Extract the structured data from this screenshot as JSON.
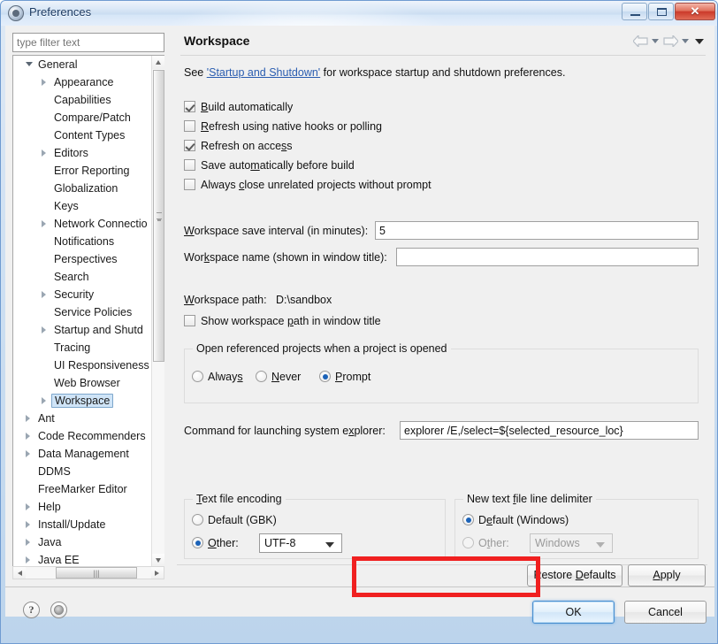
{
  "window": {
    "title": "Preferences",
    "icon": "gear-icon",
    "controls": {
      "minimize": "minimize-icon",
      "maximize": "maximize-icon",
      "close": "close-icon"
    }
  },
  "sidebar": {
    "filter": {
      "placeholder": "type filter text",
      "value": ""
    },
    "tree": [
      {
        "label": "General",
        "level": 0,
        "expander": "open",
        "selected": false
      },
      {
        "label": "Appearance",
        "level": 1,
        "expander": "collapsed",
        "selected": false
      },
      {
        "label": "Capabilities",
        "level": 1,
        "expander": "none",
        "selected": false
      },
      {
        "label": "Compare/Patch",
        "level": 1,
        "expander": "none",
        "selected": false
      },
      {
        "label": "Content Types",
        "level": 1,
        "expander": "none",
        "selected": false
      },
      {
        "label": "Editors",
        "level": 1,
        "expander": "collapsed",
        "selected": false
      },
      {
        "label": "Error Reporting",
        "level": 1,
        "expander": "none",
        "selected": false
      },
      {
        "label": "Globalization",
        "level": 1,
        "expander": "none",
        "selected": false
      },
      {
        "label": "Keys",
        "level": 1,
        "expander": "none",
        "selected": false
      },
      {
        "label": "Network Connectio",
        "level": 1,
        "expander": "collapsed",
        "selected": false
      },
      {
        "label": "Notifications",
        "level": 1,
        "expander": "none",
        "selected": false
      },
      {
        "label": "Perspectives",
        "level": 1,
        "expander": "none",
        "selected": false
      },
      {
        "label": "Search",
        "level": 1,
        "expander": "none",
        "selected": false
      },
      {
        "label": "Security",
        "level": 1,
        "expander": "collapsed",
        "selected": false
      },
      {
        "label": "Service Policies",
        "level": 1,
        "expander": "none",
        "selected": false
      },
      {
        "label": "Startup and Shutd",
        "level": 1,
        "expander": "collapsed",
        "selected": false
      },
      {
        "label": "Tracing",
        "level": 1,
        "expander": "none",
        "selected": false
      },
      {
        "label": "UI Responsiveness",
        "level": 1,
        "expander": "none",
        "selected": false
      },
      {
        "label": "Web Browser",
        "level": 1,
        "expander": "none",
        "selected": false
      },
      {
        "label": "Workspace",
        "level": 1,
        "expander": "collapsed",
        "selected": true
      },
      {
        "label": "Ant",
        "level": 0,
        "expander": "collapsed",
        "selected": false
      },
      {
        "label": "Code Recommenders",
        "level": 0,
        "expander": "collapsed",
        "selected": false
      },
      {
        "label": "Data Management",
        "level": 0,
        "expander": "collapsed",
        "selected": false
      },
      {
        "label": "DDMS",
        "level": 0,
        "expander": "none",
        "selected": false
      },
      {
        "label": "FreeMarker Editor",
        "level": 0,
        "expander": "none",
        "selected": false
      },
      {
        "label": "Help",
        "level": 0,
        "expander": "collapsed",
        "selected": false
      },
      {
        "label": "Install/Update",
        "level": 0,
        "expander": "collapsed",
        "selected": false
      },
      {
        "label": "Java",
        "level": 0,
        "expander": "collapsed",
        "selected": false
      },
      {
        "label": "Java EE",
        "level": 0,
        "expander": "collapsed",
        "selected": false
      }
    ]
  },
  "page": {
    "title": "Workspace",
    "nav": {
      "back": "back-arrow-icon",
      "back_menu": "chevron-down-icon",
      "forward": "forward-arrow-icon",
      "forward_menu": "chevron-down-icon",
      "view_menu": "view-menu-icon"
    },
    "intro": {
      "prefix": "See ",
      "link": "'Startup and Shutdown'",
      "suffix": " for workspace startup and shutdown preferences."
    },
    "checkboxes": [
      {
        "label": "Build automatically",
        "mnemonic": "B",
        "checked": true
      },
      {
        "label": "Refresh using native hooks or polling",
        "mnemonic": "R",
        "checked": false
      },
      {
        "label": "Refresh on access",
        "mnemonic": "s",
        "checked": true
      },
      {
        "label": "Save automatically before build",
        "mnemonic": "m",
        "checked": false
      },
      {
        "label": "Always close unrelated projects without prompt",
        "mnemonic": "c",
        "checked": false
      }
    ],
    "save_interval": {
      "label": "Workspace save interval (in minutes):",
      "value": "5"
    },
    "workspace_name": {
      "label": "Workspace name (shown in window title):",
      "value": ""
    },
    "workspace_path": {
      "label": "Workspace path:",
      "value": "D:\\sandbox"
    },
    "show_path_checkbox": {
      "label": "Show workspace path in window title",
      "checked": false
    },
    "referenced_projects": {
      "title": "Open referenced projects when a project is opened",
      "options": [
        {
          "label": "Always",
          "selected": false
        },
        {
          "label": "Never",
          "selected": false
        },
        {
          "label": "Prompt",
          "selected": true
        }
      ]
    },
    "explorer_command": {
      "label": "Command for launching system explorer:",
      "value": "explorer /E,/select=${selected_resource_loc}"
    },
    "text_file_encoding": {
      "title": "Text file encoding",
      "default_option": {
        "label": "Default (GBK)",
        "selected": false
      },
      "other_option": {
        "label": "Other:",
        "selected": true
      },
      "other_value": "UTF-8"
    },
    "line_delimiter": {
      "title": "New text file line delimiter",
      "default_option": {
        "label": "Default (Windows)",
        "selected": true
      },
      "other_option": {
        "label": "Other:",
        "selected": false,
        "disabled": true
      },
      "other_value": "Windows"
    },
    "buttons": {
      "restore_defaults": "Restore Defaults",
      "apply": "Apply"
    }
  },
  "footer": {
    "help_icon": "?",
    "config_icon": "gear-icon",
    "ok": "OK",
    "cancel": "Cancel"
  },
  "annotation": {
    "highlight_color": "#f02020",
    "target": "text-file-encoding-other-row"
  }
}
